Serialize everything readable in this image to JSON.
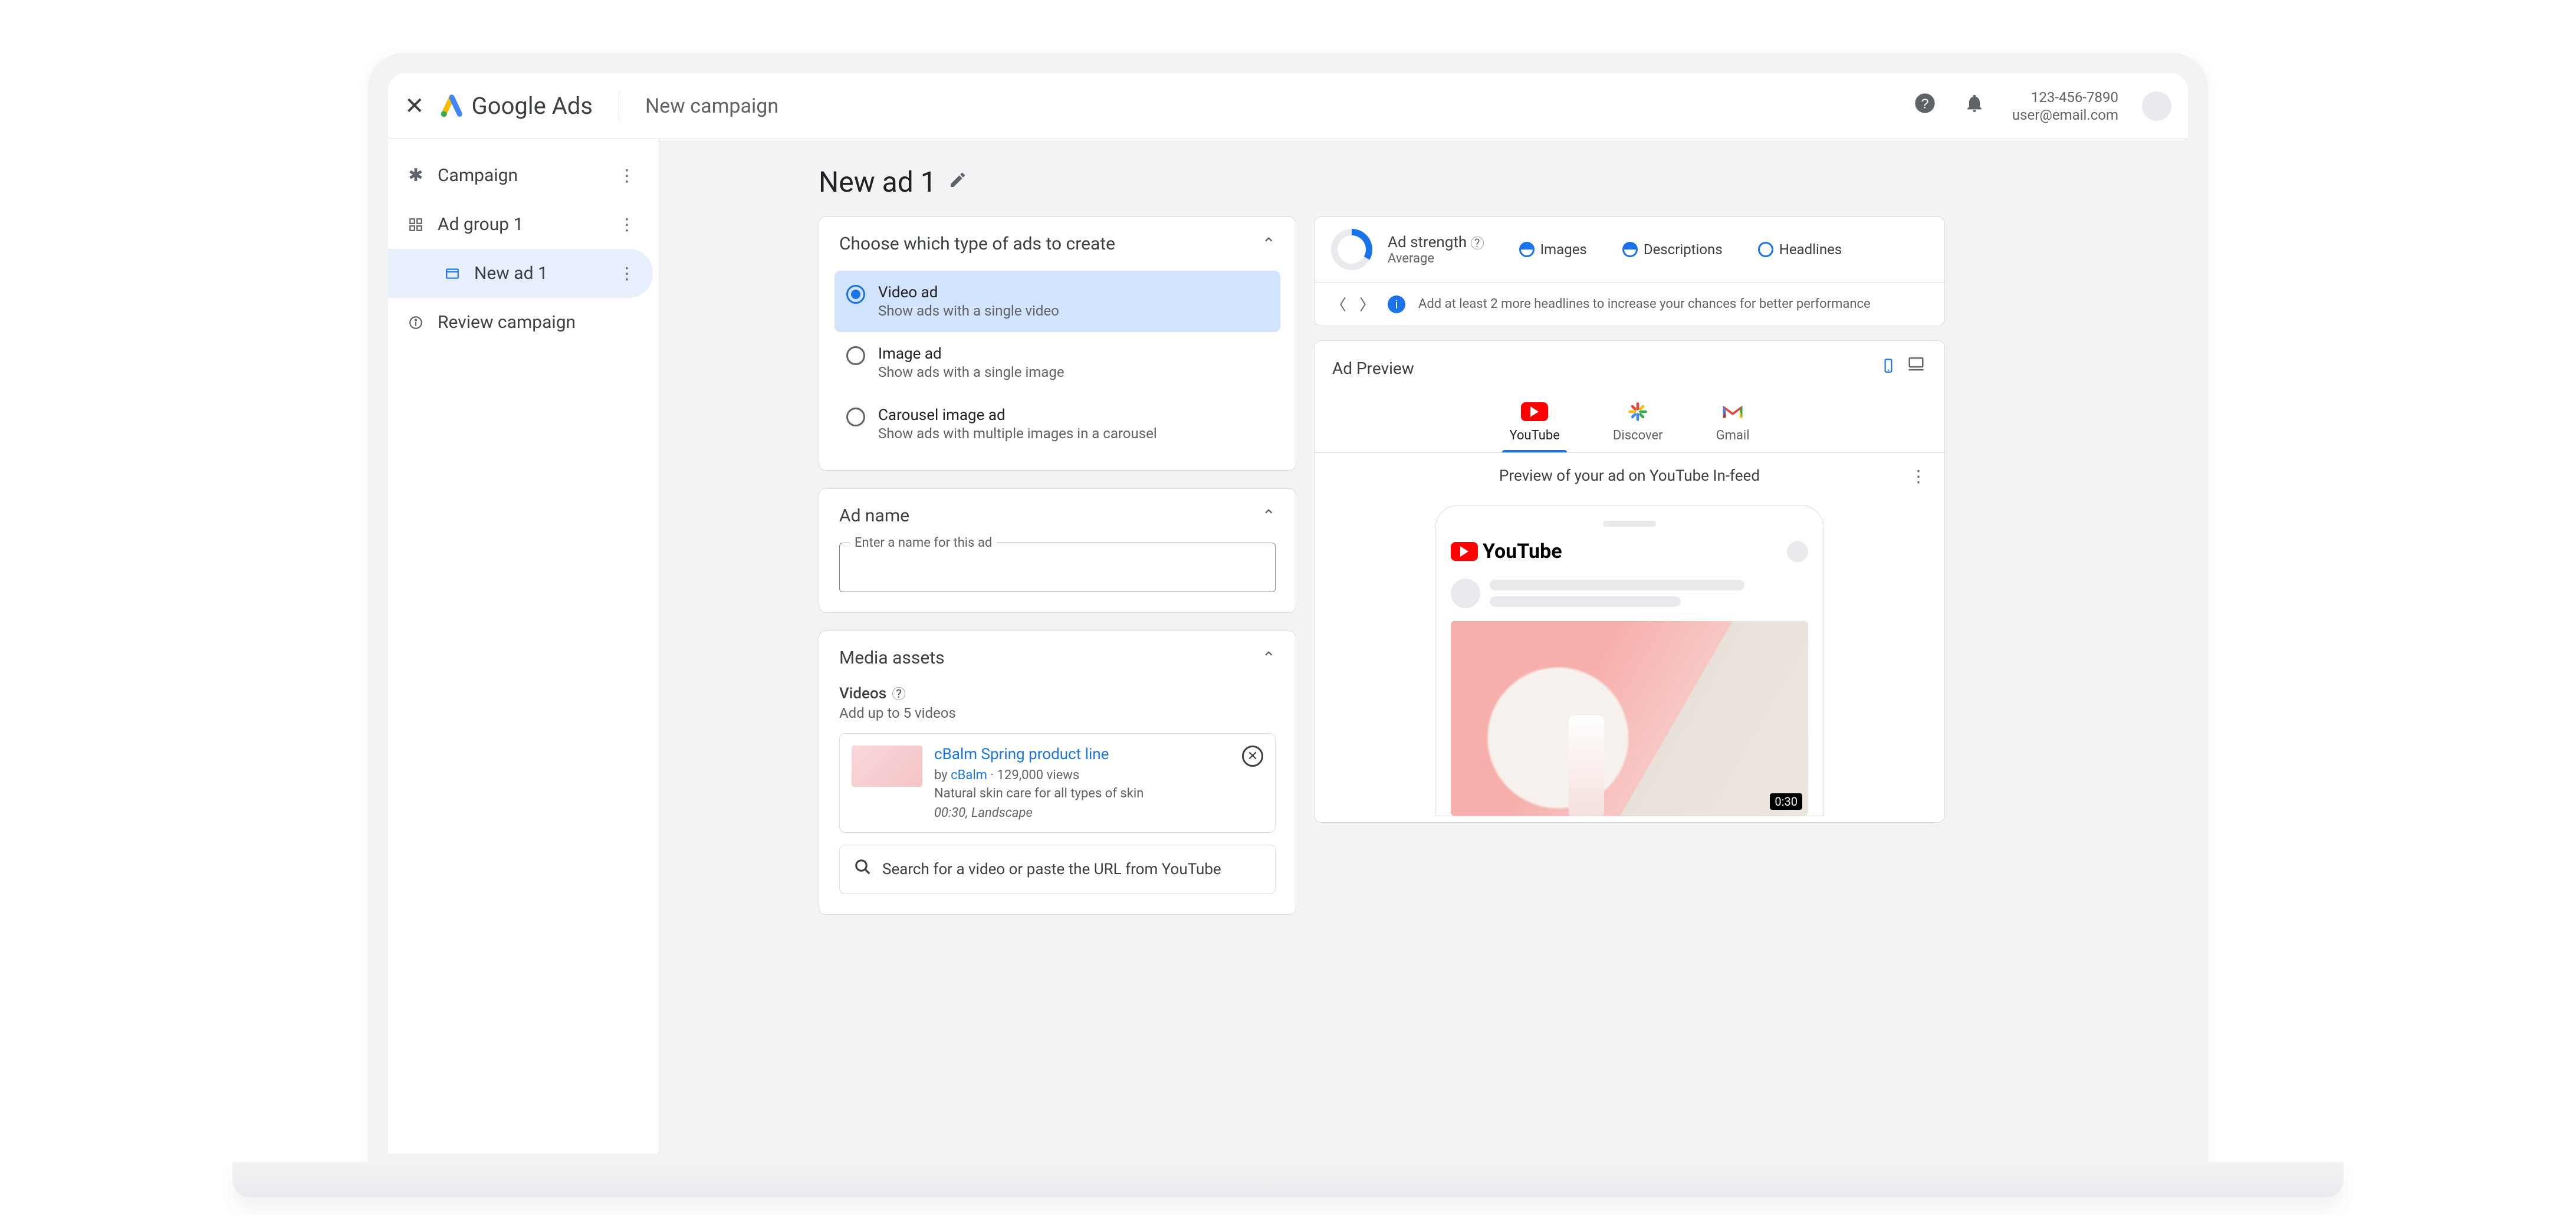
{
  "header": {
    "brand": "Google Ads",
    "breadcrumb": "New campaign",
    "account_id": "123-456-7890",
    "account_email": "user@email.com"
  },
  "sidebar": {
    "items": [
      {
        "label": "Campaign"
      },
      {
        "label": "Ad group 1"
      },
      {
        "label": "New ad 1"
      },
      {
        "label": "Review campaign"
      }
    ]
  },
  "page": {
    "title": "New ad 1"
  },
  "ad_type": {
    "heading": "Choose which type of ads to create",
    "options": [
      {
        "title": "Video ad",
        "sub": "Show ads with a single video"
      },
      {
        "title": "Image ad",
        "sub": "Show ads with a single image"
      },
      {
        "title": "Carousel image ad",
        "sub": "Show ads with multiple images in a carousel"
      }
    ]
  },
  "ad_name": {
    "heading": "Ad name",
    "label": "Enter a name for this ad"
  },
  "media": {
    "heading": "Media assets",
    "section_title": "Videos",
    "hint": "Add up to 5 videos",
    "video": {
      "title": "cBalm Spring product line",
      "by_prefix": "by",
      "author": "cBalm",
      "views": "129,000 views",
      "desc": "Natural skin care for all types of skin",
      "dims": "00:30, Landscape"
    },
    "search_placeholder": "Search for a video or paste the URL from YouTube"
  },
  "strength": {
    "title": "Ad strength",
    "value": "Average",
    "checks": [
      "Images",
      "Descriptions",
      "Headlines"
    ],
    "tip": "Add at least 2 more headlines to increase your chances for better performance"
  },
  "preview": {
    "title": "Ad Preview",
    "tabs": [
      "YouTube",
      "Discover",
      "Gmail"
    ],
    "caption": "Preview of your ad on YouTube In-feed",
    "youtube_word": "YouTube",
    "duration": "0:30"
  }
}
